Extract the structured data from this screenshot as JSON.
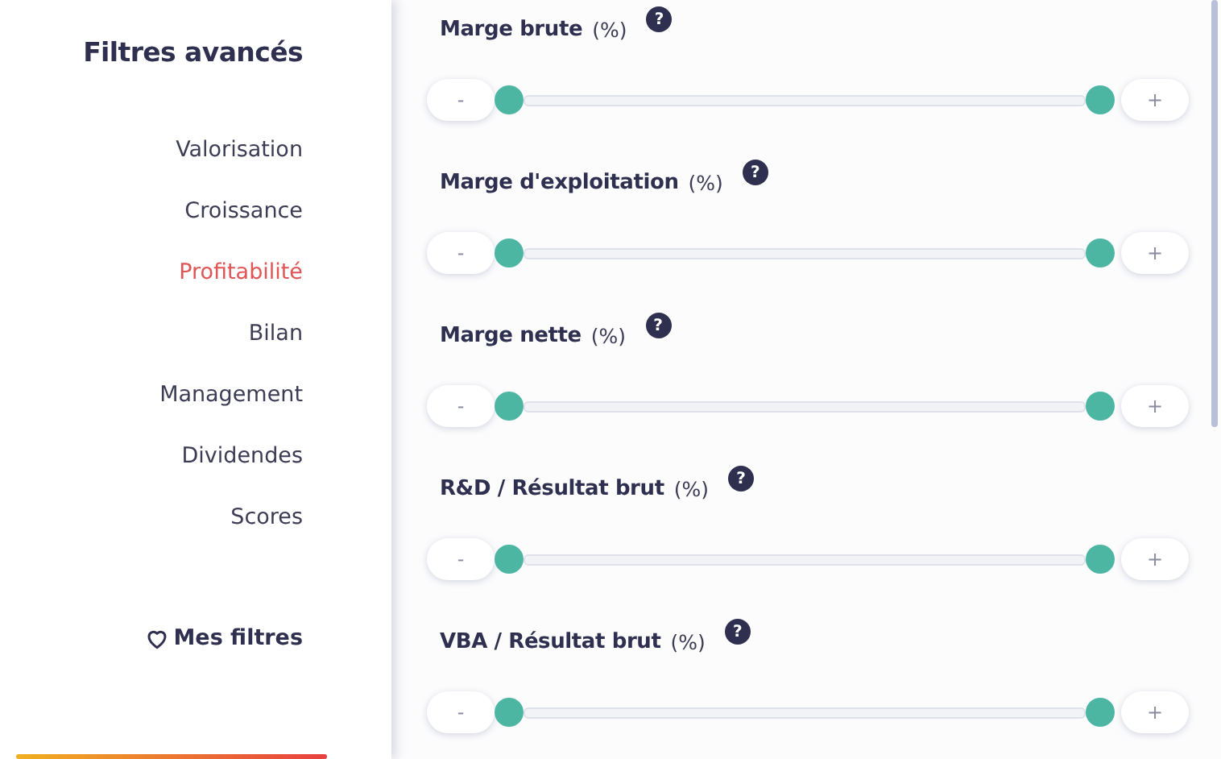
{
  "sidebar": {
    "title": "Filtres avancés",
    "items": [
      {
        "label": "Valorisation",
        "selected": false
      },
      {
        "label": "Croissance",
        "selected": false
      },
      {
        "label": "Profitabilité",
        "selected": true
      },
      {
        "label": "Bilan",
        "selected": false
      },
      {
        "label": "Management",
        "selected": false
      },
      {
        "label": "Dividendes",
        "selected": false
      },
      {
        "label": "Scores",
        "selected": false
      }
    ],
    "favorites": "Mes filtres"
  },
  "filters": [
    {
      "label": "Marge brute",
      "unit": "(%)",
      "help": "?",
      "minus": "-",
      "plus": "+"
    },
    {
      "label": "Marge d'exploitation",
      "unit": "(%)",
      "help": "?",
      "minus": "-",
      "plus": "+"
    },
    {
      "label": "Marge nette",
      "unit": "(%)",
      "help": "?",
      "minus": "-",
      "plus": "+"
    },
    {
      "label": "R&D / Résultat brut",
      "unit": "(%)",
      "help": "?",
      "minus": "-",
      "plus": "+"
    },
    {
      "label": "VBA / Résultat brut",
      "unit": "(%)",
      "help": "?",
      "minus": "-",
      "plus": "+"
    }
  ]
}
